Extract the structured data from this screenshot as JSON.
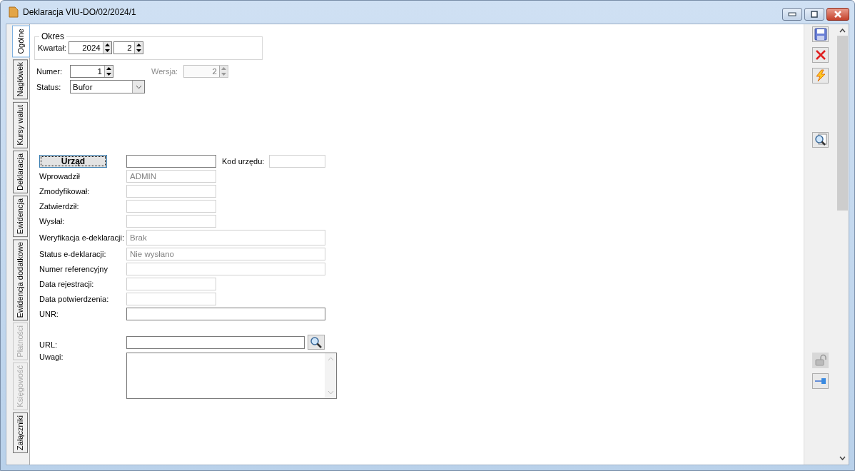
{
  "window": {
    "title": "Deklaracja VIU-DO/02/2024/1"
  },
  "tabs": [
    {
      "label": "Ogólne",
      "selected": true,
      "disabled": false
    },
    {
      "label": "Nagłówek",
      "selected": false,
      "disabled": false
    },
    {
      "label": "Kursy walut",
      "selected": false,
      "disabled": false
    },
    {
      "label": "Deklaracja",
      "selected": false,
      "disabled": false
    },
    {
      "label": "Ewidencja",
      "selected": false,
      "disabled": false
    },
    {
      "label": "Ewidencja dodatkowe",
      "selected": false,
      "disabled": false
    },
    {
      "label": "Płatności",
      "selected": false,
      "disabled": true
    },
    {
      "label": "Księgowość",
      "selected": false,
      "disabled": true
    },
    {
      "label": "Załączniki",
      "selected": false,
      "disabled": false
    }
  ],
  "period": {
    "legend": "Okres",
    "label": "Kwartał:",
    "year": "2024",
    "quarter": "2"
  },
  "number": {
    "label": "Numer:",
    "value": "1",
    "disabled": false
  },
  "version": {
    "label": "Wersja:",
    "value": "2",
    "disabled": true
  },
  "status": {
    "label": "Status:",
    "value": "Bufor"
  },
  "office": {
    "button": "Urząd",
    "code_label": "Kod urzędu:"
  },
  "fields": [
    {
      "label": "Wprowadził",
      "value": "ADMIN",
      "disabled": true,
      "kind": "short"
    },
    {
      "label": "Zmodyfikował:",
      "disabled": true,
      "kind": "short"
    },
    {
      "label": "Zatwierdził:",
      "disabled": true,
      "kind": "short"
    },
    {
      "label": "Wysłał:",
      "disabled": true,
      "kind": "short"
    },
    {
      "label": "Weryfikacja e-deklaracji:",
      "value": "Brak",
      "disabled": true,
      "kind": "tall"
    },
    {
      "label": "Status e-deklaracji:",
      "value": "Nie wysłano",
      "disabled": true,
      "kind": "wide"
    },
    {
      "label": "Numer referencyjny",
      "disabled": true,
      "kind": "wide"
    },
    {
      "label": "Data rejestracji:",
      "disabled": true,
      "kind": "short"
    },
    {
      "label": "Data potwierdzenia:",
      "disabled": true,
      "kind": "short"
    },
    {
      "label": "UNR:",
      "disabled": false,
      "kind": "wide"
    }
  ],
  "url": {
    "label": "URL:"
  },
  "notes": {
    "label": "Uwagi:"
  },
  "toolbar": [
    {
      "kind": "save",
      "disabled": false
    },
    {
      "kind": "delete",
      "disabled": false
    },
    {
      "kind": "run",
      "disabled": false
    },
    {
      "kind": "preview",
      "disabled": false
    }
  ],
  "toolbar_bottom": [
    {
      "kind": "lock",
      "disabled": true
    },
    {
      "kind": "pin",
      "disabled": false
    }
  ]
}
